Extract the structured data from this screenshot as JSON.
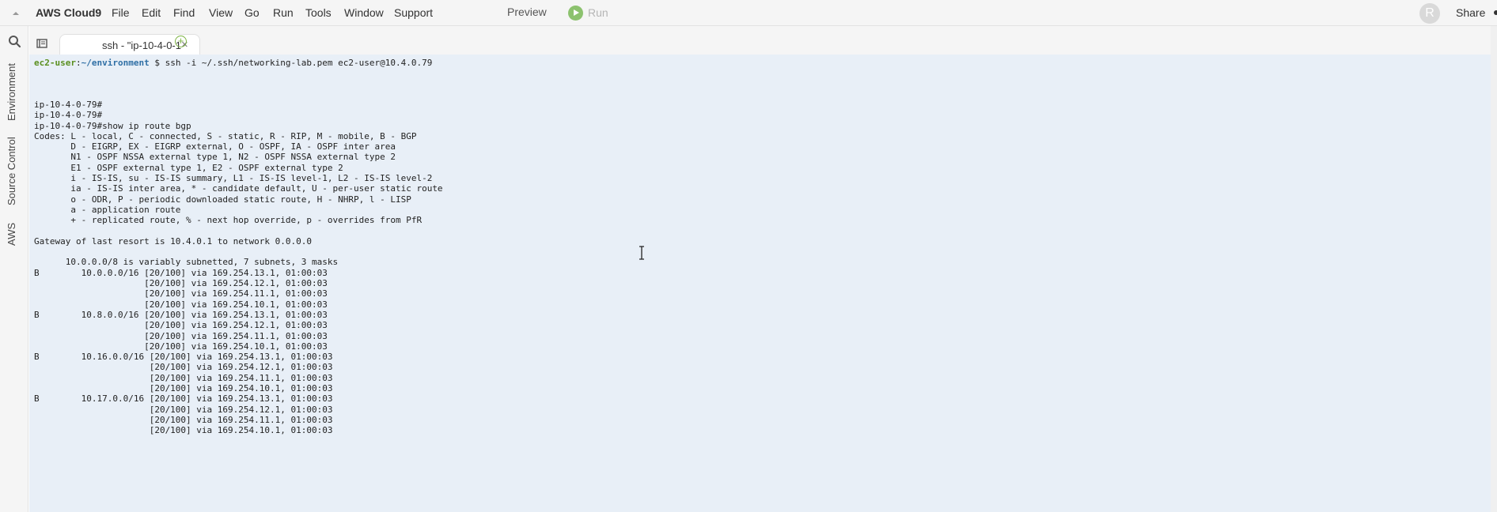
{
  "menubar": {
    "brand": "AWS Cloud9",
    "items": [
      "File",
      "Edit",
      "Find",
      "View",
      "Go",
      "Run",
      "Tools",
      "Window",
      "Support"
    ],
    "preview": "Preview",
    "run": "Run",
    "avatar_initial": "R",
    "share": "Share"
  },
  "leftrail": {
    "tabs": [
      "Environment",
      "Source Control",
      "AWS"
    ]
  },
  "tabbar": {
    "tab_label": "ssh - \"ip-10-4-0-1",
    "close": "×",
    "add": "+"
  },
  "terminal": {
    "prompt_user": "ec2-user",
    "prompt_sep": ":",
    "prompt_path": "~/environment",
    "prompt_cmd": " $ ssh -i ~/.ssh/networking-lab.pem ec2-user@10.4.0.79",
    "lines": [
      "",
      "",
      "",
      "ip-10-4-0-79#",
      "ip-10-4-0-79#",
      "ip-10-4-0-79#show ip route bgp",
      "Codes: L - local, C - connected, S - static, R - RIP, M - mobile, B - BGP",
      "       D - EIGRP, EX - EIGRP external, O - OSPF, IA - OSPF inter area",
      "       N1 - OSPF NSSA external type 1, N2 - OSPF NSSA external type 2",
      "       E1 - OSPF external type 1, E2 - OSPF external type 2",
      "       i - IS-IS, su - IS-IS summary, L1 - IS-IS level-1, L2 - IS-IS level-2",
      "       ia - IS-IS inter area, * - candidate default, U - per-user static route",
      "       o - ODR, P - periodic downloaded static route, H - NHRP, l - LISP",
      "       a - application route",
      "       + - replicated route, % - next hop override, p - overrides from PfR",
      "",
      "Gateway of last resort is 10.4.0.1 to network 0.0.0.0",
      "",
      "      10.0.0.0/8 is variably subnetted, 7 subnets, 3 masks",
      "B        10.0.0.0/16 [20/100] via 169.254.13.1, 01:00:03",
      "                     [20/100] via 169.254.12.1, 01:00:03",
      "                     [20/100] via 169.254.11.1, 01:00:03",
      "                     [20/100] via 169.254.10.1, 01:00:03",
      "B        10.8.0.0/16 [20/100] via 169.254.13.1, 01:00:03",
      "                     [20/100] via 169.254.12.1, 01:00:03",
      "                     [20/100] via 169.254.11.1, 01:00:03",
      "                     [20/100] via 169.254.10.1, 01:00:03",
      "B        10.16.0.0/16 [20/100] via 169.254.13.1, 01:00:03",
      "                      [20/100] via 169.254.12.1, 01:00:03",
      "                      [20/100] via 169.254.11.1, 01:00:03",
      "                      [20/100] via 169.254.10.1, 01:00:03",
      "B        10.17.0.0/16 [20/100] via 169.254.13.1, 01:00:03",
      "                      [20/100] via 169.254.12.1, 01:00:03",
      "                      [20/100] via 169.254.11.1, 01:00:03",
      "                      [20/100] via 169.254.10.1, 01:00:03"
    ]
  }
}
